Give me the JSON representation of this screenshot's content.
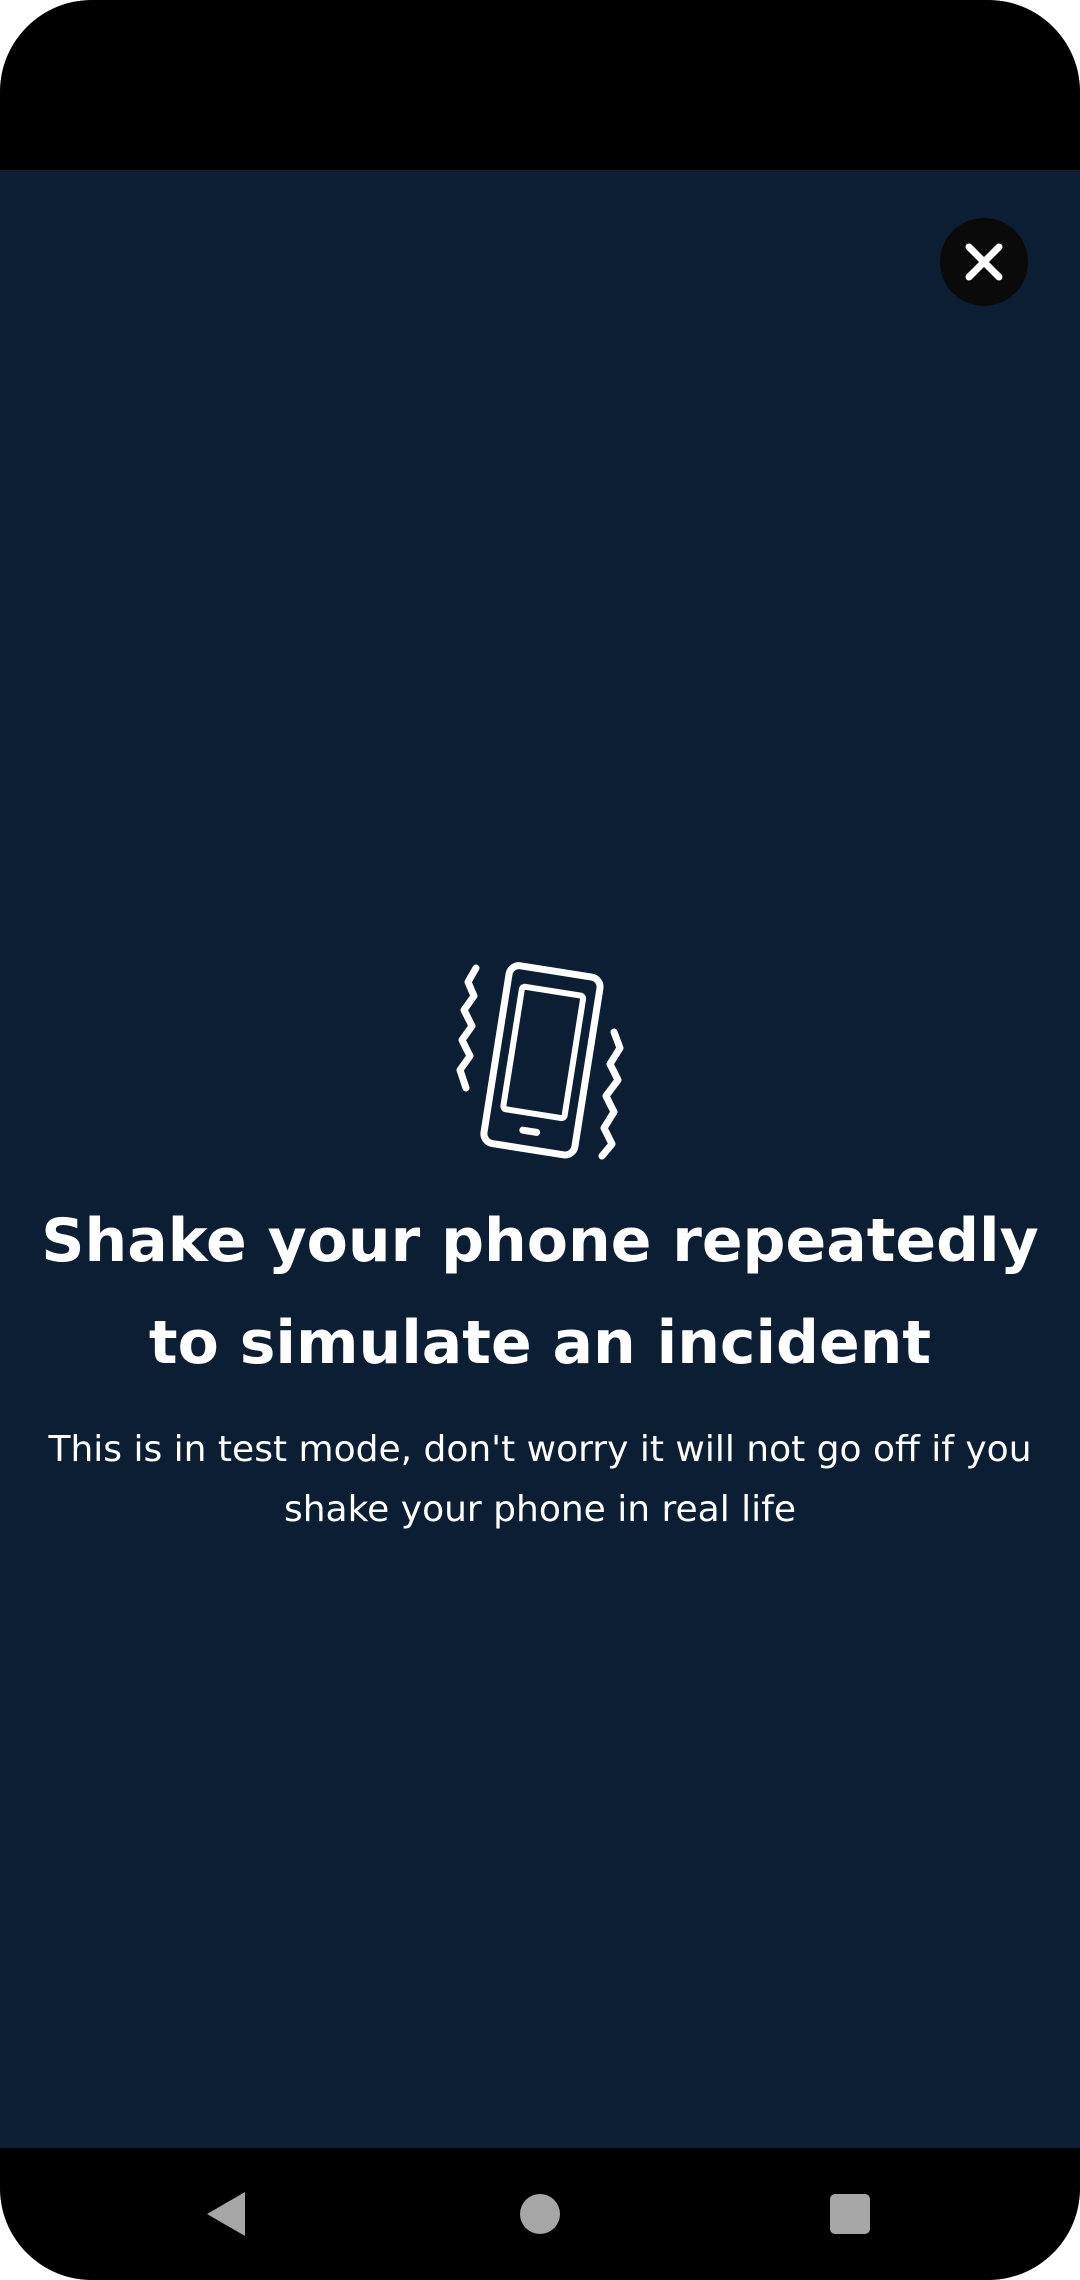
{
  "overlay": {
    "close_icon": "close-icon",
    "illustration_icon": "phone-vibrate-icon",
    "title": "Shake your phone repeatedly to simulate an incident",
    "subtitle": "This is in test mode, don't worry it will not go off if you shake your phone in real life"
  },
  "nav_bar": {
    "back_icon": "back-icon",
    "home_icon": "home-icon",
    "recents_icon": "recents-icon"
  },
  "colors": {
    "background": "#0c1e33",
    "text": "#ffffff",
    "close_button_bg": "#0a0a0a",
    "nav_icon": "#a6a6a6"
  }
}
